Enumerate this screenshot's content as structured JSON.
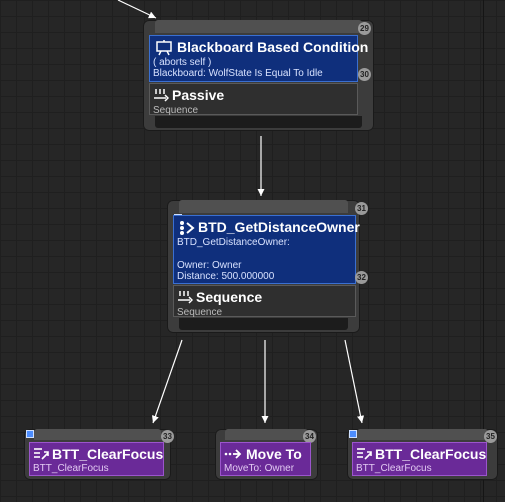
{
  "colors": {
    "background": "#262626",
    "decorator": "#0f2f7c",
    "task": "#6a2a98",
    "composite": "#2f2f2f"
  },
  "root_node": {
    "index_top": "29",
    "decorator": {
      "icon": "blackboard-icon",
      "title": "Blackboard Based Condition",
      "line1": "( aborts self )",
      "line2": "Blackboard: WolfState Is Equal To Idle",
      "index": "30"
    },
    "composite": {
      "icon": "sequence-icon",
      "title": "Passive",
      "subtitle": "Sequence"
    }
  },
  "middle_node": {
    "index_top": "31",
    "decorator": {
      "icon": "service-decorator-icon",
      "title": "BTD_GetDistanceOwner",
      "line1": "BTD_GetDistanceOwner:",
      "line2": "",
      "line3": "Owner: Owner",
      "line4": "Distance: 500.000000",
      "index": "32"
    },
    "composite": {
      "icon": "sequence-icon",
      "title": "Sequence",
      "subtitle": "Sequence"
    }
  },
  "tasks": [
    {
      "icon": "clear-focus-icon",
      "title": "BTT_ClearFocus",
      "subtitle": "BTT_ClearFocus",
      "index": "33"
    },
    {
      "icon": "move-to-icon",
      "title": "Move To",
      "subtitle": "MoveTo: Owner",
      "index": "34"
    },
    {
      "icon": "clear-focus-icon",
      "title": "BTT_ClearFocus",
      "subtitle": "BTT_ClearFocus",
      "index": "35"
    }
  ]
}
